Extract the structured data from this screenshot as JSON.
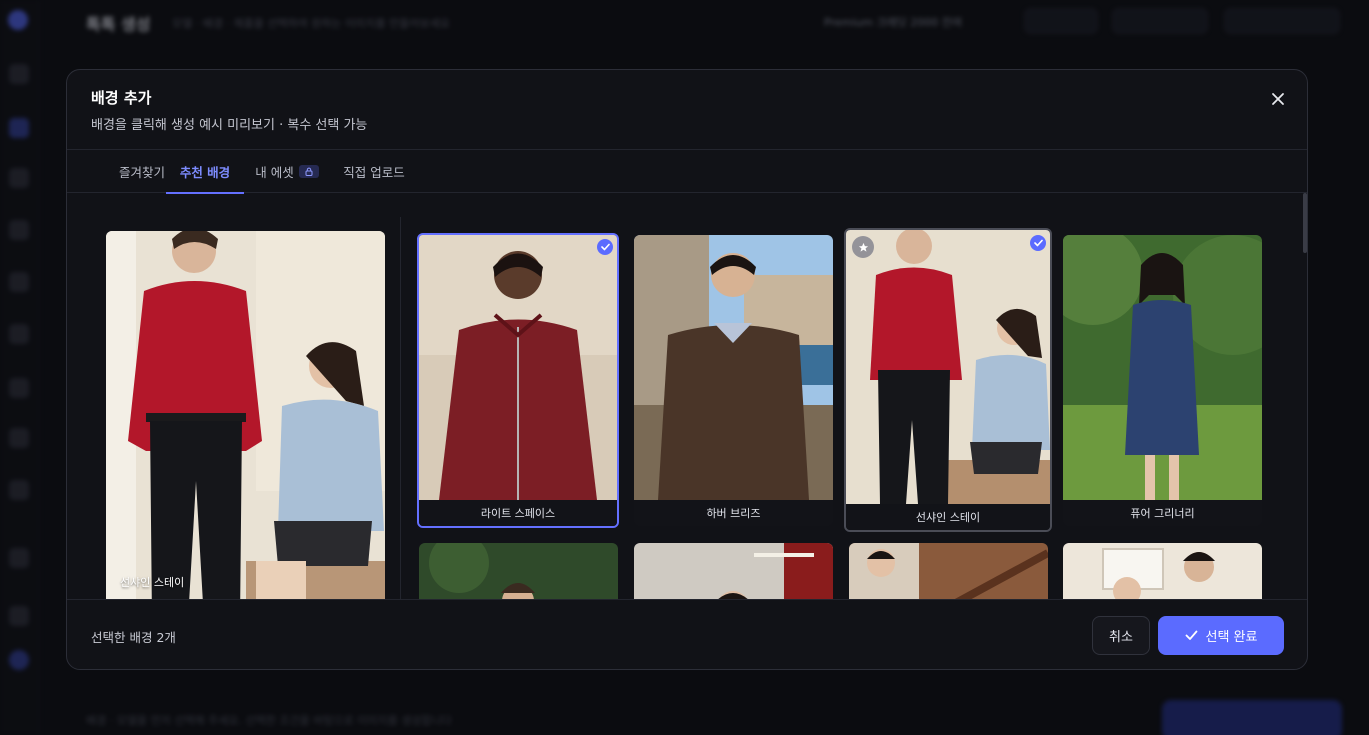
{
  "background": {
    "title": "톡톡 생성",
    "subtitle": "모델 · 배경 · 제품을 선택하여 원하는 이미지를 만들어보세요",
    "credit_text": "Premium 크레딧 2000 잔여",
    "bottom_text": "배경 · 모델을 먼저 선택해 주세요. 선택한 조건을 바탕으로 이미지를 생성합니다"
  },
  "modal": {
    "title": "배경 추가",
    "subtitle": "배경을 클릭해 생성 예시 미리보기 · 복수 선택 가능",
    "close_icon": "close-icon",
    "tabs": [
      {
        "label": "즐겨찾기",
        "active": false
      },
      {
        "label": "추천 배경",
        "active": true
      },
      {
        "label": "내 에셋",
        "active": false,
        "icon": "lock-icon"
      },
      {
        "label": "직접 업로드",
        "active": false
      }
    ],
    "preview": {
      "label": "선샤인 스테이"
    },
    "cards": [
      {
        "name": "라이트 스페이스",
        "selected": true,
        "favorite": false
      },
      {
        "name": "하버 브리즈",
        "selected": false,
        "favorite": false
      },
      {
        "name": "선샤인 스테이",
        "selected": true,
        "favorite": true
      },
      {
        "name": "퓨어 그리너리",
        "selected": false,
        "favorite": false
      }
    ],
    "footer": {
      "status": "선택한 배경 2개",
      "cancel_label": "취소",
      "confirm_label": "선택 완료"
    }
  },
  "colors": {
    "accent": "#5b6bff",
    "tab_active": "#7d8cff",
    "modal_bg": "#111217"
  }
}
